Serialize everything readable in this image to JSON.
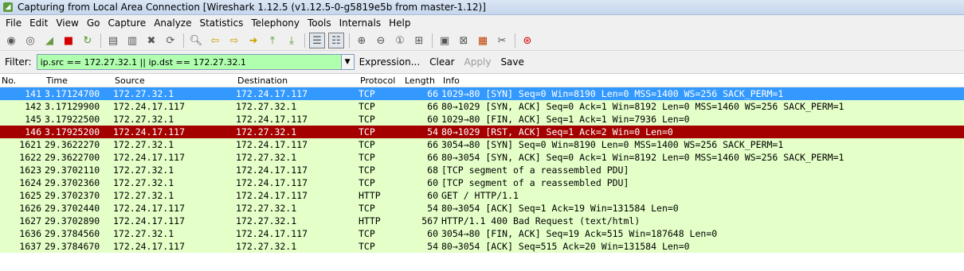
{
  "window": {
    "title": "Capturing from Local Area Connection   [Wireshark 1.12.5  (v1.12.5-0-g5819e5b from master-1.12)]"
  },
  "menu": [
    "File",
    "Edit",
    "View",
    "Go",
    "Capture",
    "Analyze",
    "Statistics",
    "Telephony",
    "Tools",
    "Internals",
    "Help"
  ],
  "filter": {
    "label": "Filter:",
    "value": "ip.src == 172.27.32.1 || ip.dst == 172.27.32.1",
    "expression": "Expression...",
    "clear": "Clear",
    "apply": "Apply",
    "save": "Save"
  },
  "columns": {
    "no": "No.",
    "time": "Time",
    "source": "Source",
    "destination": "Destination",
    "protocol": "Protocol",
    "length": "Length",
    "info": "Info"
  },
  "packets": [
    {
      "no": "141",
      "time": "3.17124700",
      "src": "172.27.32.1",
      "dst": "172.24.17.117",
      "proto": "TCP",
      "len": "66",
      "info": "1029→80 [SYN] Seq=0 Win=8190 Len=0 MSS=1400 WS=256 SACK_PERM=1",
      "style": "selected"
    },
    {
      "no": "142",
      "time": "3.17129900",
      "src": "172.24.17.117",
      "dst": "172.27.32.1",
      "proto": "TCP",
      "len": "66",
      "info": "80→1029 [SYN, ACK] Seq=0 Ack=1 Win=8192 Len=0 MSS=1460 WS=256 SACK_PERM=1",
      "style": "normal"
    },
    {
      "no": "145",
      "time": "3.17922500",
      "src": "172.27.32.1",
      "dst": "172.24.17.117",
      "proto": "TCP",
      "len": "60",
      "info": "1029→80 [FIN, ACK] Seq=1 Ack=1 Win=7936 Len=0",
      "style": "normal"
    },
    {
      "no": "146",
      "time": "3.17925200",
      "src": "172.24.17.117",
      "dst": "172.27.32.1",
      "proto": "TCP",
      "len": "54",
      "info": "80→1029 [RST, ACK] Seq=1 Ack=2 Win=0 Len=0",
      "style": "rst"
    },
    {
      "no": "1621",
      "time": "29.3622270",
      "src": "172.27.32.1",
      "dst": "172.24.17.117",
      "proto": "TCP",
      "len": "66",
      "info": "3054→80 [SYN] Seq=0 Win=8190 Len=0 MSS=1400 WS=256 SACK_PERM=1",
      "style": "normal"
    },
    {
      "no": "1622",
      "time": "29.3622700",
      "src": "172.24.17.117",
      "dst": "172.27.32.1",
      "proto": "TCP",
      "len": "66",
      "info": "80→3054 [SYN, ACK] Seq=0 Ack=1 Win=8192 Len=0 MSS=1460 WS=256 SACK_PERM=1",
      "style": "normal"
    },
    {
      "no": "1623",
      "time": "29.3702110",
      "src": "172.27.32.1",
      "dst": "172.24.17.117",
      "proto": "TCP",
      "len": "68",
      "info": "[TCP segment of a reassembled PDU]",
      "style": "normal"
    },
    {
      "no": "1624",
      "time": "29.3702360",
      "src": "172.27.32.1",
      "dst": "172.24.17.117",
      "proto": "TCP",
      "len": "60",
      "info": "[TCP segment of a reassembled PDU]",
      "style": "normal"
    },
    {
      "no": "1625",
      "time": "29.3702370",
      "src": "172.27.32.1",
      "dst": "172.24.17.117",
      "proto": "HTTP",
      "len": "60",
      "info": "GET / HTTP/1.1",
      "style": "normal"
    },
    {
      "no": "1626",
      "time": "29.3702440",
      "src": "172.24.17.117",
      "dst": "172.27.32.1",
      "proto": "TCP",
      "len": "54",
      "info": "80→3054 [ACK] Seq=1 Ack=19 Win=131584 Len=0",
      "style": "normal"
    },
    {
      "no": "1627",
      "time": "29.3702890",
      "src": "172.24.17.117",
      "dst": "172.27.32.1",
      "proto": "HTTP",
      "len": "567",
      "info": "HTTP/1.1 400 Bad Request  (text/html)",
      "style": "normal"
    },
    {
      "no": "1636",
      "time": "29.3784560",
      "src": "172.27.32.1",
      "dst": "172.24.17.117",
      "proto": "TCP",
      "len": "60",
      "info": "3054→80 [FIN, ACK] Seq=19 Ack=515 Win=187648 Len=0",
      "style": "normal"
    },
    {
      "no": "1637",
      "time": "29.3784670",
      "src": "172.24.17.117",
      "dst": "172.27.32.1",
      "proto": "TCP",
      "len": "54",
      "info": "80→3054 [ACK] Seq=515 Ack=20 Win=131584 Len=0",
      "style": "normal"
    }
  ],
  "colors": {
    "selected": "#3399ff",
    "rst": "#a40000",
    "tcp_row": "#e4ffc7",
    "filter_valid": "#afffaf"
  }
}
